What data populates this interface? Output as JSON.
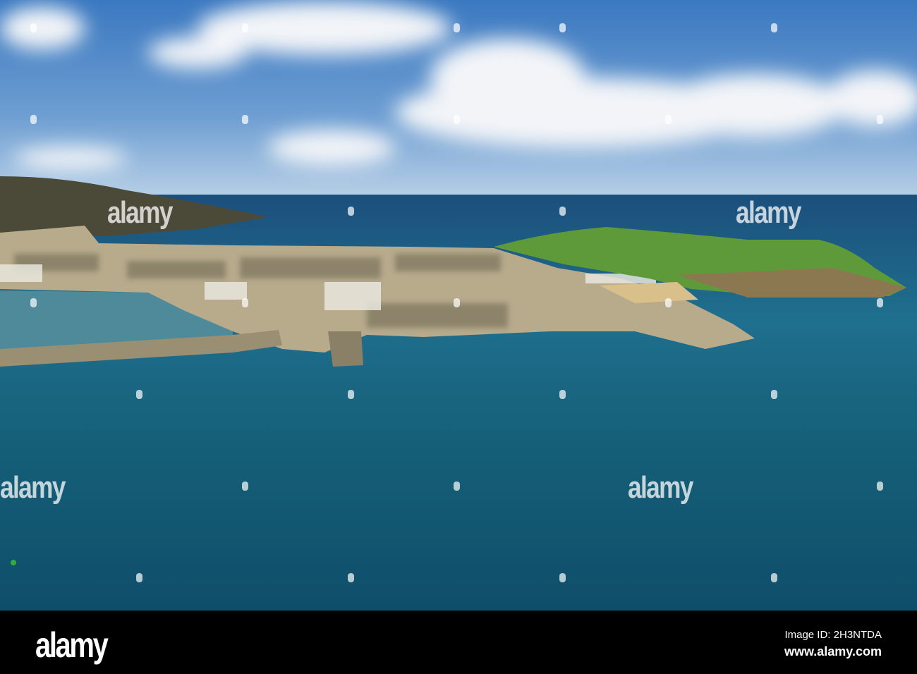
{
  "photo": {
    "subject": "Aerial view of coastal harbour town with green headland",
    "watermark_text": "alamy"
  },
  "footer": {
    "logo": "alamy",
    "image_id": "Image ID: 2H3NTDA",
    "url": "www.alamy.com"
  },
  "colors": {
    "sky_top": "#3f7fc4",
    "sky_horizon": "#a9c9e6",
    "sea_far": "#1d5e85",
    "sea_near": "#135a6e",
    "grass": "#5f9a3a",
    "town": "#b9ad8e"
  }
}
